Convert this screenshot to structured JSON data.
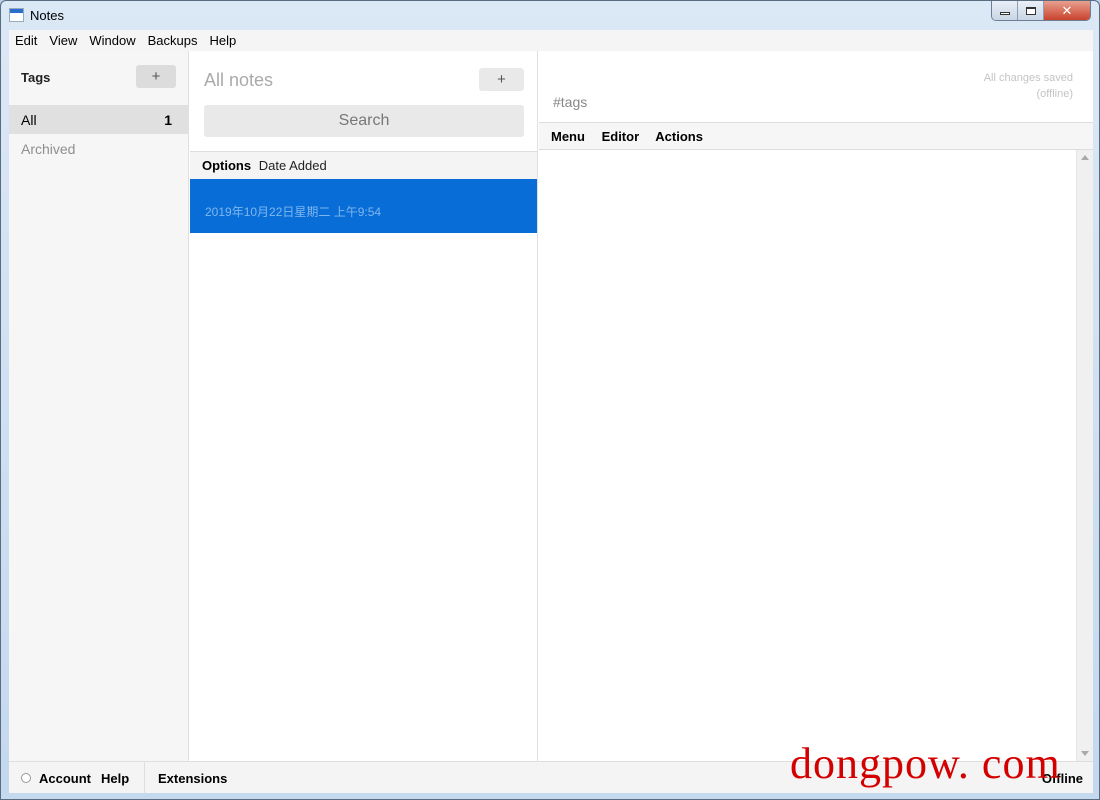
{
  "window": {
    "title": "Notes",
    "controls": {
      "minimize": "minimize",
      "maximize": "maximize",
      "close": "✕"
    }
  },
  "menubar": [
    "Edit",
    "View",
    "Window",
    "Backups",
    "Help"
  ],
  "tags": {
    "title": "Tags",
    "add_label": "+",
    "items": [
      {
        "label": "All",
        "count": "1"
      },
      {
        "label": "Archived",
        "count": ""
      }
    ]
  },
  "notes": {
    "title": "All notes",
    "add_label": "+",
    "search_placeholder": "Search",
    "options_label": "Options",
    "sort_label": "Date Added",
    "items": [
      {
        "date": "2019年10月22日星期二 上午9:54"
      }
    ],
    "selected_color": "#086dd6"
  },
  "editor": {
    "tags_placeholder": "#tags",
    "save_status_line1": "All changes saved",
    "save_status_line2": "(offline)",
    "toolbar": [
      "Menu",
      "Editor",
      "Actions"
    ]
  },
  "footer": {
    "account": "Account",
    "help": "Help",
    "extensions": "Extensions",
    "status": "Offline"
  },
  "watermark": "dongpow. com"
}
